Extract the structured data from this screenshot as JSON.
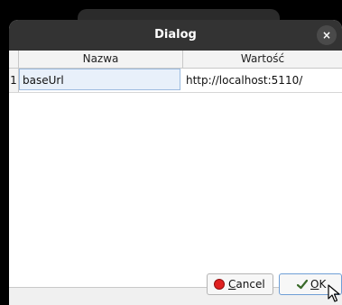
{
  "dialog": {
    "title": "Dialog",
    "close_glyph": "×"
  },
  "table": {
    "columns": [
      "Nazwa",
      "Wartość"
    ],
    "rows": [
      {
        "index": "1",
        "name": "baseUrl",
        "value": "http://localhost:5110/"
      }
    ]
  },
  "buttons": {
    "cancel": {
      "mnemonic": "C",
      "rest": "ancel",
      "icon": "stop-icon"
    },
    "ok": {
      "mnemonic": "O",
      "rest": "K",
      "icon": "checkmark-icon"
    }
  },
  "colors": {
    "titlebar": "#333333",
    "dialog_bg": "#f0f0f0",
    "selected_cell": "#e8f0fa",
    "cancel_icon": "#e02020"
  }
}
